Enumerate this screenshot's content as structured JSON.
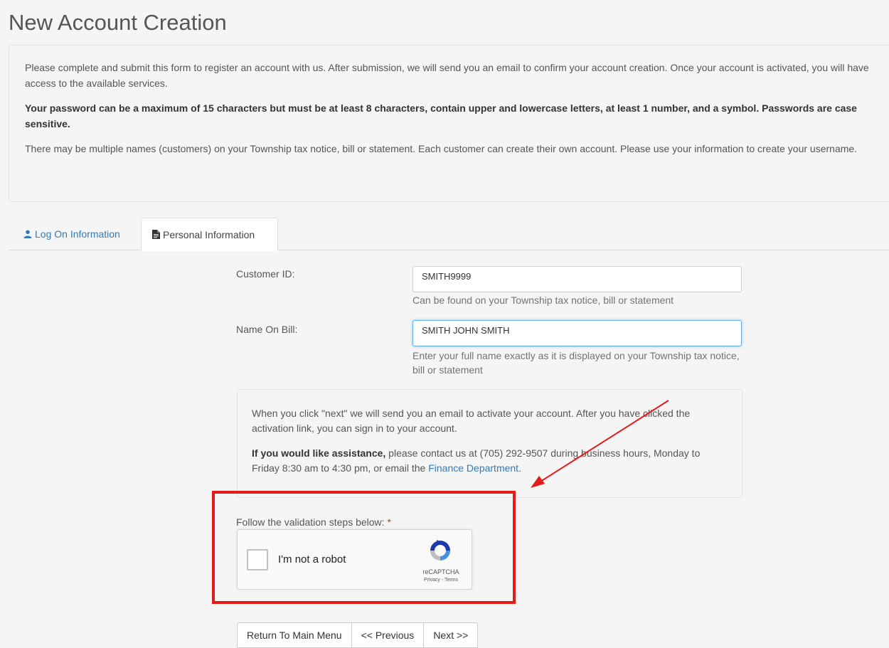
{
  "page": {
    "title": "New Account Creation"
  },
  "intro": {
    "p1": "Please complete and submit this form to register an account with us. After submission, we will send you an email to confirm your account creation. Once your account is activated, you will have access to the available services.",
    "p2": "Your password can be a maximum of 15 characters but must be at least 8 characters, contain upper and lowercase letters, at least 1 number, and a symbol. Passwords are case sensitive.",
    "p3": "There may be multiple names (customers) on your Township tax notice, bill or statement. Each customer can create their own account. Please use your information to create your username."
  },
  "tabs": [
    {
      "label": "Log On Information",
      "icon": "user-icon",
      "active": false
    },
    {
      "label": "Personal Information",
      "icon": "document-icon",
      "active": true
    }
  ],
  "form": {
    "customer_id": {
      "label": "Customer ID:",
      "value": "SMITH9999",
      "help": "Can be found on your Township tax notice, bill or statement"
    },
    "name_on_bill": {
      "label": "Name On Bill:",
      "value": "SMITH JOHN SMITH",
      "help": "Enter your full name exactly as it is displayed on your Township tax notice, bill or statement"
    }
  },
  "info": {
    "p1": "When you click \"next\" we will send you an email to activate your account. After you have clicked the activation link, you can sign in to your account.",
    "assist_bold": "If you would like assistance,",
    "assist_text": " please contact us at (705) 292-9507 during business hours, Monday to Friday 8:30 am to 4:30 pm, or email the ",
    "link": "Finance Department",
    "end": "."
  },
  "validation": {
    "label": "Follow the validation steps below:",
    "required": "*"
  },
  "recaptcha": {
    "label": "I'm not a robot",
    "brand": "reCAPTCHA",
    "links": "Privacy - Terms",
    "checked": false
  },
  "buttons": {
    "return": "Return To Main Menu",
    "previous": "<< Previous",
    "next": "Next >>"
  },
  "colors": {
    "link": "#337ab7",
    "annotation": "#e31b1b"
  }
}
